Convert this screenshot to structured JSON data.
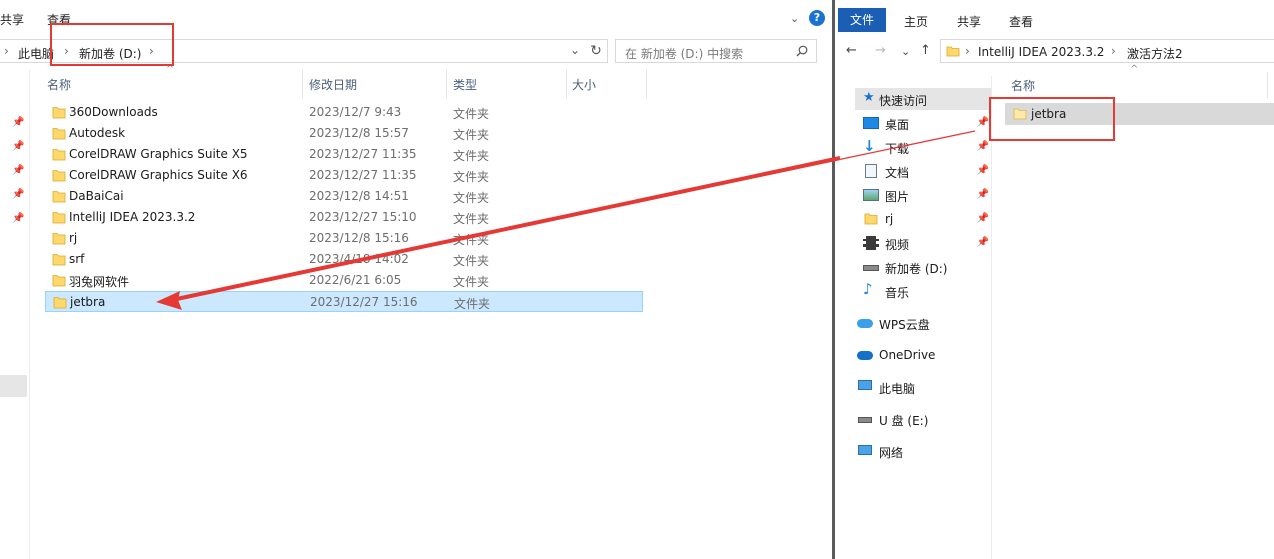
{
  "left": {
    "ribbon": {
      "share_tab": "共享",
      "view_tab": "查看"
    },
    "address": {
      "this_pc": "此电脑",
      "drive": "新加卷 (D:)"
    },
    "search": {
      "placeholder": "在 新加卷 (D:) 中搜索"
    },
    "columns": {
      "name": "名称",
      "modified": "修改日期",
      "type": "类型",
      "size": "大小"
    },
    "files": [
      {
        "name": "360Downloads",
        "date": "2023/12/7 9:43",
        "type": "文件夹"
      },
      {
        "name": "Autodesk",
        "date": "2023/12/8 15:57",
        "type": "文件夹"
      },
      {
        "name": "CorelDRAW Graphics Suite X5",
        "date": "2023/12/27 11:35",
        "type": "文件夹"
      },
      {
        "name": "CorelDRAW Graphics Suite X6",
        "date": "2023/12/27 11:35",
        "type": "文件夹"
      },
      {
        "name": "DaBaiCai",
        "date": "2023/12/8 14:51",
        "type": "文件夹"
      },
      {
        "name": "IntelliJ IDEA 2023.3.2",
        "date": "2023/12/27 15:10",
        "type": "文件夹"
      },
      {
        "name": "rj",
        "date": "2023/12/8 15:16",
        "type": "文件夹"
      },
      {
        "name": "srf",
        "date": "2023/4/18 14:02",
        "type": "文件夹"
      },
      {
        "name": "羽兔网软件",
        "date": "2022/6/21 6:05",
        "type": "文件夹"
      },
      {
        "name": "jetbra",
        "date": "2023/12/27 15:16",
        "type": "文件夹",
        "selected": true
      }
    ]
  },
  "right": {
    "ribbon": {
      "file_tab": "文件",
      "home_tab": "主页",
      "share_tab": "共享",
      "view_tab": "查看"
    },
    "address": {
      "folder": "IntelliJ IDEA 2023.3.2",
      "sub": "激活方法2"
    },
    "columns": {
      "name": "名称"
    },
    "files": [
      {
        "name": "jetbra"
      }
    ],
    "nav": {
      "quick_access": "快速访问",
      "desktop": "桌面",
      "downloads": "下载",
      "documents": "文档",
      "pictures": "图片",
      "rj": "rj",
      "videos": "视频",
      "drive_d": "新加卷 (D:)",
      "music": "音乐",
      "wps": "WPS云盘",
      "onedrive": "OneDrive",
      "this_pc": "此电脑",
      "usb": "U 盘 (E:)",
      "network": "网络"
    }
  },
  "colors": {
    "selection": "#cce8ff",
    "accent": "#1a5fb4",
    "annotation": "#e53935"
  },
  "icons": [
    "folder-icon",
    "pin-icon",
    "refresh-icon",
    "search-icon",
    "back-arrow-icon",
    "forward-arrow-icon",
    "up-arrow-icon",
    "chevron-down-icon"
  ]
}
